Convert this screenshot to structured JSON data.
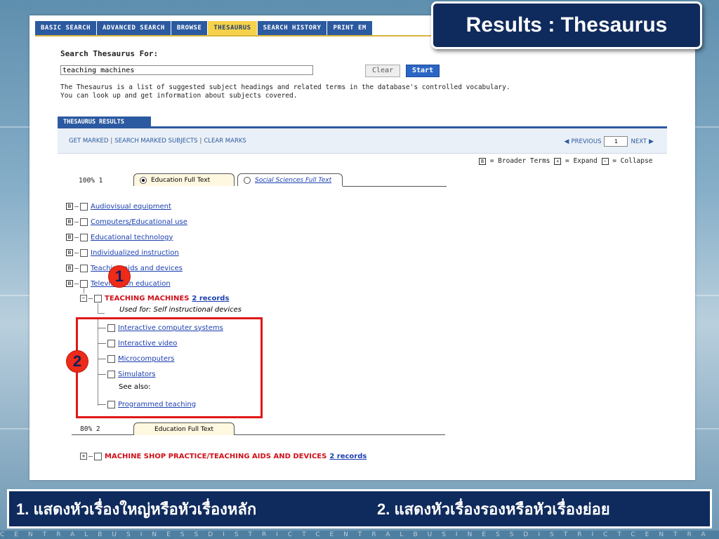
{
  "slide": {
    "title": "Results : Thesaurus",
    "caption_1": "1. แสดงหัวเรื่องใหญ่หรือหัวเรื่องหลัก",
    "caption_2": "2. แสดงหัวเรื่องรองหรือหัวเรื่องย่อย",
    "footer_text": "CENTRALBUSINESSDISTRICTCENTRALBUSINESSDISTRICTCENTRA",
    "callouts": [
      "1",
      "2"
    ]
  },
  "tabs": [
    {
      "label": "BASIC SEARCH"
    },
    {
      "label": "ADVANCED SEARCH"
    },
    {
      "label": "BROWSE"
    },
    {
      "label": "THESAURUS"
    },
    {
      "label": "SEARCH HISTORY"
    },
    {
      "label": "PRINT EM"
    }
  ],
  "search": {
    "label": "Search Thesaurus For:",
    "value": "teaching machines",
    "clear_label": "Clear",
    "start_label": "Start",
    "description_line1": "The Thesaurus is a list of suggested subject headings and related terms in the database's controlled vocabulary.",
    "description_line2": "You can look up and get information about subjects covered."
  },
  "results": {
    "tab_label": "THESAURUS RESULTS",
    "links": [
      "GET MARKED",
      "SEARCH MARKED SUBJECTS",
      "CLEAR MARKS"
    ],
    "previous_label": "PREVIOUS",
    "next_label": "NEXT",
    "page_value": "1",
    "legend": {
      "broader_glyph": "B",
      "broader": "= Broader Terms",
      "expand": "= Expand",
      "collapse": "= Collapse"
    },
    "group1": {
      "percent": "100% 1",
      "tab_active": "Education Full Text",
      "tab_other": "Social Sciences Full Text"
    },
    "broader_terms": [
      "Audiovisual equipment",
      "Computers/Educational use",
      "Educational technology",
      "Individualized instruction",
      "Teaching aids and devices",
      "Television in education"
    ],
    "main_term": "TEACHING MACHINES",
    "main_records": "2 records",
    "used_for": "Used for: Self instructional devices",
    "narrower_terms": [
      "Interactive computer systems",
      "Interactive video",
      "Microcomputers",
      "Simulators"
    ],
    "see_also_label": "See also:",
    "see_also_term": "Programmed teaching",
    "group2": {
      "percent": "80% 2",
      "tab_active": "Education Full Text",
      "term": "MACHINE SHOP PRACTICE/TEACHING AIDS AND DEVICES",
      "records": "2 records"
    }
  },
  "colors": {
    "navy": "#0f2a5c",
    "tab_blue": "#2c5aa0",
    "tab_active": "#f6d24a",
    "link_blue": "#1a3fb0",
    "term_red": "#d0101a",
    "highlight_red": "#e01818"
  }
}
